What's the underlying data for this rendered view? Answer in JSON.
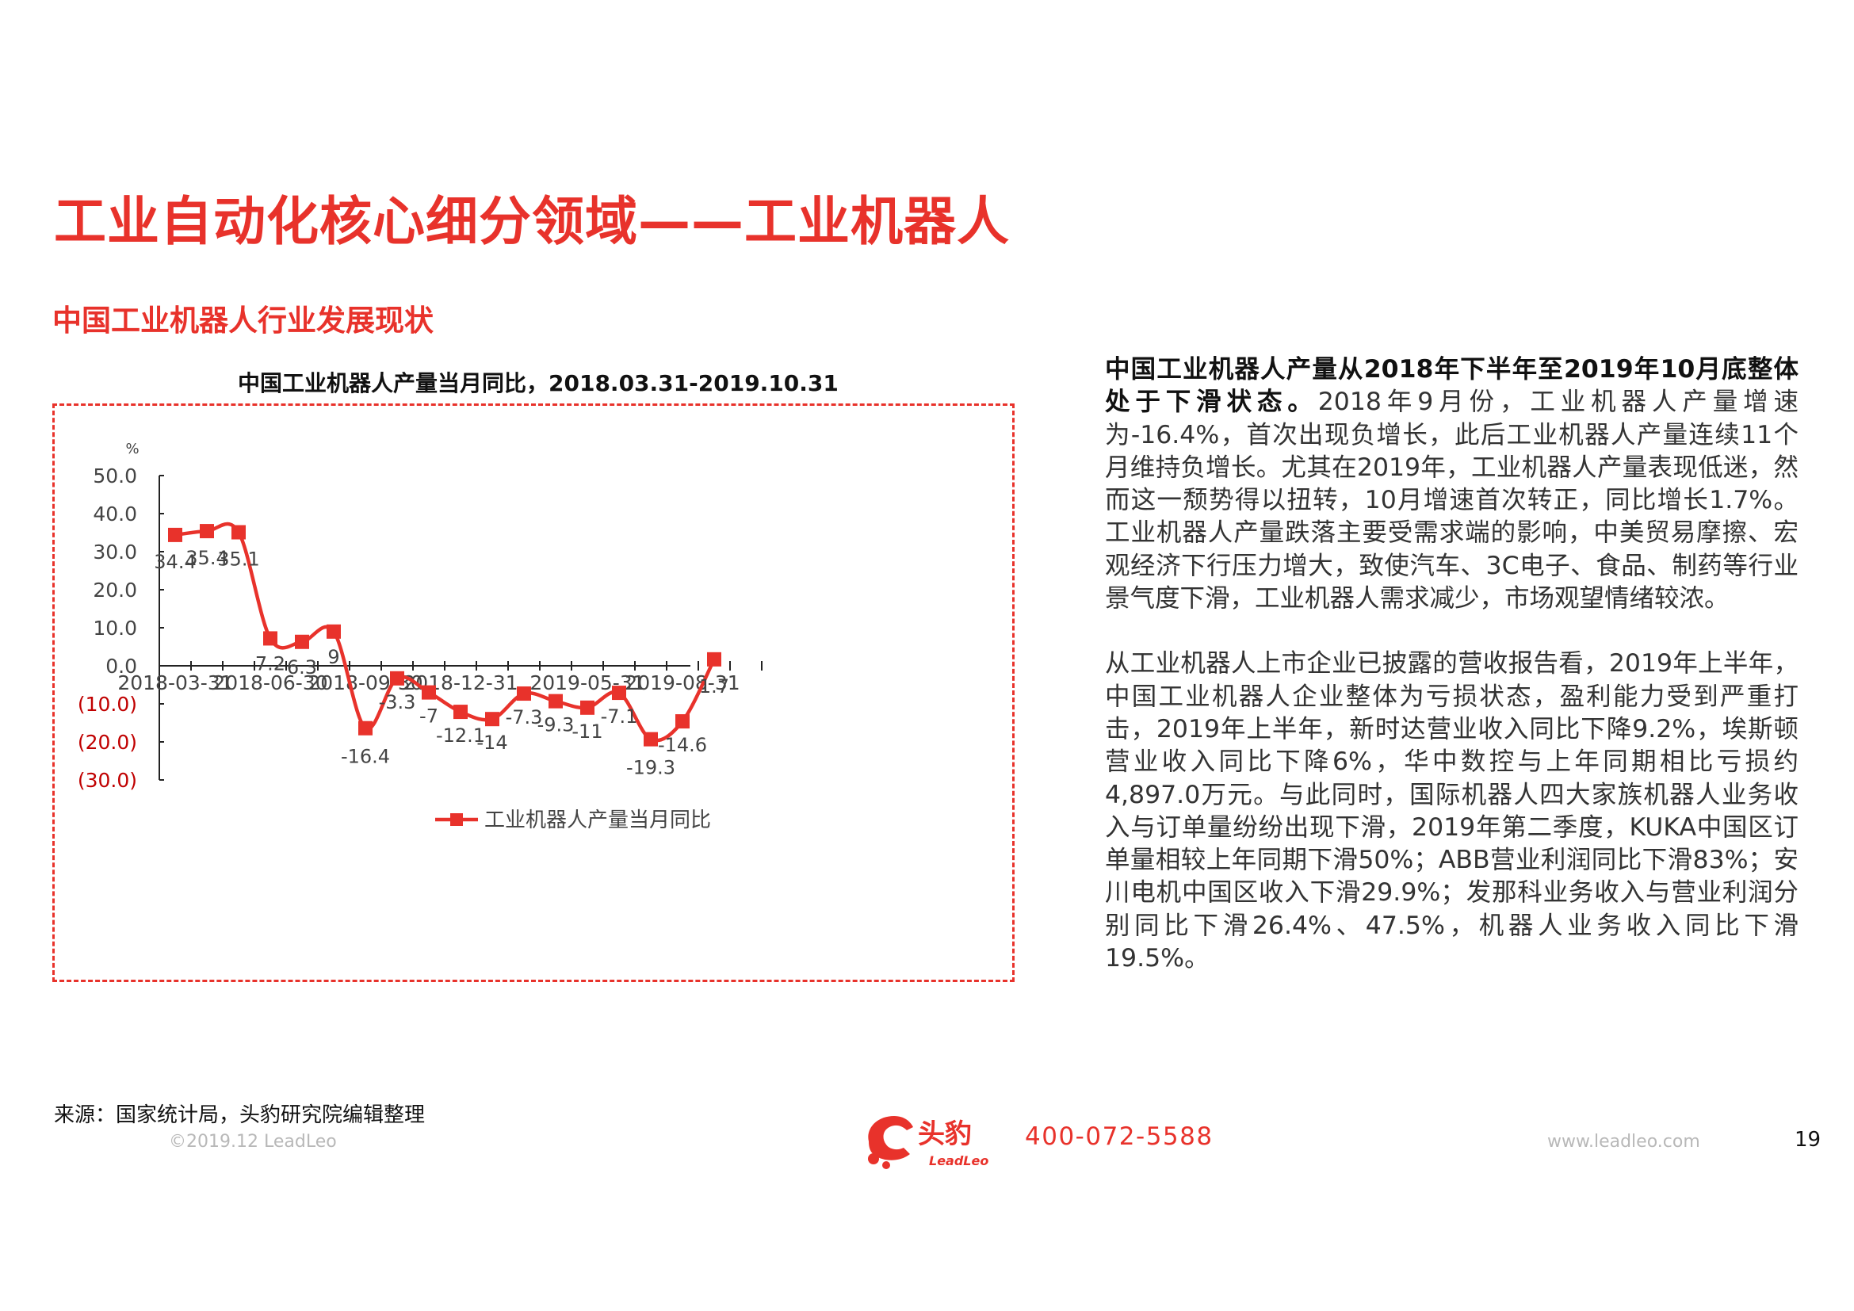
{
  "page": {
    "title": "工业自动化核心细分领域——工业机器人",
    "subtitle": "中国工业机器人行业发展现状",
    "source": "来源：国家统计局，头豹研究院编辑整理",
    "copyright": "©2019.12 LeadLeo",
    "phone": "400-072-5588",
    "website": "www.leadleo.com",
    "page_number": "19",
    "logo": {
      "cn": "头豹",
      "en": "LeadLeo"
    }
  },
  "text": {
    "p1_bold": "中国工业机器人产量从2018年下半年至2019年10月底整体处于下滑状态。",
    "p1_rest": "2018年9月份，工业机器人产量增速为-16.4%，首次出现负增长，此后工业机器人产量连续11个月维持负增长。尤其在2019年，工业机器人产量表现低迷，然而这一颓势得以扭转，10月增速首次转正，同比增长1.7%。工业机器人产量跌落主要受需求端的影响，中美贸易摩擦、宏观经济下行压力增大，致使汽车、3C电子、食品、制药等行业景气度下滑，工业机器人需求减少，市场观望情绪较浓。",
    "p2": "从工业机器人上市企业已披露的营收报告看，2019年上半年，中国工业机器人企业整体为亏损状态，盈利能力受到严重打击，2019年上半年，新时达营业收入同比下降9.2%，埃斯顿营业收入同比下降6%，华中数控与上年同期相比亏损约4,897.0万元。与此同时，国际机器人四大家族机器人业务收入与订单量纷纷出现下滑，2019年第二季度，KUKA中国区订单量相较上年同期下滑50%；ABB营业利润同比下滑83%；安川电机中国区收入下滑29.9%；发那科业务收入与营业利润分别同比下滑26.4%、47.5%，机器人业务收入同比下滑19.5%。"
  },
  "colors": {
    "accent": "#e8322b",
    "negative_tick": "#c00000"
  },
  "chart_data": {
    "type": "line",
    "title": "中国工业机器人产量当月同比，2018.03.31-2019.10.31",
    "ylabel": "%",
    "ylim": [
      -30,
      50
    ],
    "yticks": [
      50,
      40,
      30,
      20,
      10,
      0,
      -10,
      -20,
      -30
    ],
    "ytick_labels": [
      "50.0",
      "40.0",
      "30.0",
      "20.0",
      "10.0",
      "0.0",
      "(10.0)",
      "(20.0)",
      "(30.0)"
    ],
    "x_tick_labels": [
      "2018-03-31",
      "2018-06-30",
      "2018-09-30",
      "2018-12-31",
      "2019-05-31",
      "2019-08-31"
    ],
    "x": [
      "2018-03-31",
      "2018-04-30",
      "2018-05-31",
      "2018-06-30",
      "2018-07-31",
      "2018-08-31",
      "2018-09-30",
      "2018-10-31",
      "2018-11-30",
      "2018-12-31",
      "2019-02-28",
      "2019-03-31",
      "2019-04-30",
      "2019-05-31",
      "2019-06-30",
      "2019-07-31",
      "2019-08-31",
      "2019-09-30",
      "2019-10-31"
    ],
    "series": [
      {
        "name": "工业机器人产量当月同比",
        "values": [
          34.4,
          35.4,
          35.1,
          7.2,
          6.3,
          9,
          -16.4,
          -3.3,
          -7,
          -12.1,
          -14,
          -7.3,
          -9.3,
          -11,
          -7.1,
          -19.3,
          -14.6,
          1.7
        ],
        "labels": [
          "34.4",
          "35.4",
          "35.1",
          "7.2",
          "6.3",
          "9",
          "-16.4",
          "-3.3",
          "-7",
          "-12.1",
          "-14",
          "-7.3",
          "-9.3",
          "-11",
          "-7.1",
          "-19.3",
          "-14.6",
          "1.7"
        ],
        "color": "#e8322b"
      }
    ],
    "legend": "bottom"
  }
}
